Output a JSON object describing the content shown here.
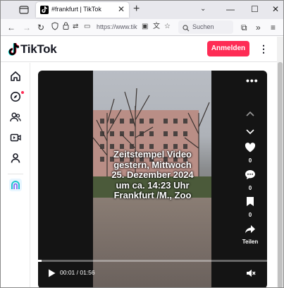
{
  "browser": {
    "tab_title": "#frankfurt | TikTok",
    "tab_close": "✕",
    "new_tab": "+",
    "url": "https://www.tiktok",
    "search_placeholder": "Suchen"
  },
  "header": {
    "logo_text": "TikTok",
    "login_label": "Anmelden",
    "more_label": "⋮"
  },
  "sidebar": {
    "items": [
      {
        "icon": "home-icon"
      },
      {
        "icon": "explore-icon",
        "has_dot": true
      },
      {
        "icon": "following-icon"
      },
      {
        "icon": "live-icon"
      },
      {
        "icon": "profile-icon"
      },
      {
        "icon": "effect-house-icon"
      }
    ],
    "dot_color": "#fe2c55"
  },
  "video": {
    "overlay_lines": [
      "Zeitstempel Video",
      "gestern, Mittwoch",
      "25. Dezember 2024",
      "um ca. 14:23 Uhr",
      "Frankfurt /M., Zoo"
    ],
    "more_label": "•••",
    "like_count": "0",
    "comment_count": "0",
    "save_count": "0",
    "share_label": "Teilen",
    "current_time": "00:01",
    "duration": "01:56",
    "time_display": "00:01 / 01:56",
    "progress": 0.01
  },
  "colors": {
    "accent": "#fe2c55",
    "text": "#161823"
  }
}
